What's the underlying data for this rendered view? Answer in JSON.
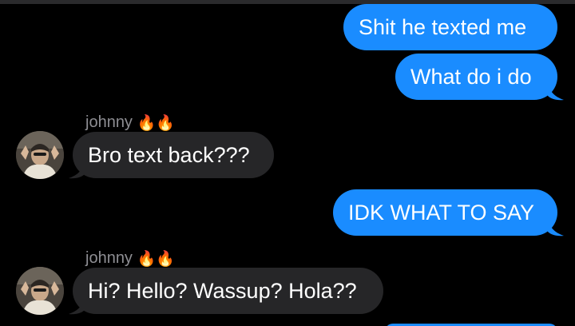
{
  "conversation": {
    "messages": [
      {
        "direction": "outgoing",
        "text": "Shit he texted me"
      },
      {
        "direction": "outgoing",
        "text": "What do i do"
      },
      {
        "direction": "incoming",
        "sender": "johnny",
        "sender_emoji": "🔥🔥",
        "text": "Bro text back???"
      },
      {
        "direction": "outgoing",
        "text": "IDK WHAT TO SAY"
      },
      {
        "direction": "incoming",
        "sender": "johnny",
        "sender_emoji": "🔥🔥",
        "text": "Hi? Hello? Wassup? Hola??"
      }
    ]
  },
  "colors": {
    "background": "#000000",
    "outgoing_bubble": "#1a8cff",
    "incoming_bubble": "#262628",
    "sender_name": "#8e8e93"
  },
  "icons": {
    "avatar": "contact-avatar-photo",
    "fire": "fire-emoji"
  }
}
